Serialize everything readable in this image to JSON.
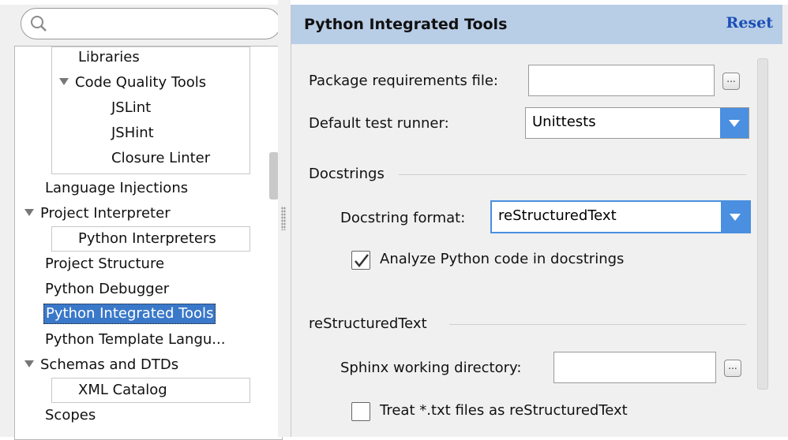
{
  "search": {
    "placeholder": ""
  },
  "tree": {
    "sub_libraries": "Libraries",
    "code_quality": "Code Quality Tools",
    "jslint": "JSLint",
    "jshint": "JSHint",
    "closure": "Closure Linter",
    "lang_inj": "Language Injections",
    "proj_interp": "Project Interpreter",
    "python_interps": "Python Interpreters",
    "proj_struct": "Project Structure",
    "py_debugger": "Python Debugger",
    "py_tools": "Python Integrated Tools",
    "py_template": "Python Template Langu...",
    "schemas": "Schemas and DTDs",
    "xml_catalog": "XML Catalog",
    "scopes": "Scopes"
  },
  "panel": {
    "title": "Python Integrated Tools",
    "reset": "Reset",
    "pkg_req_label": "Package requirements file:",
    "pkg_req_value": "",
    "test_runner_label": "Default test runner:",
    "test_runner_value": "Unittests",
    "docstrings_section": "Docstrings",
    "docstring_format_label": "Docstring format:",
    "docstring_format_value": "reStructuredText",
    "analyze_label": "Analyze Python code in docstrings",
    "analyze_checked": true,
    "rst_section": "reStructuredText",
    "sphinx_label": "Sphinx working directory:",
    "sphinx_value": "",
    "treat_txt_label": "Treat *.txt files as reStructuredText",
    "treat_txt_checked": false,
    "browse_glyph": "..."
  },
  "colors": {
    "header_bg": "#b8cde6",
    "selection": "#3a78c9",
    "accent": "#4a8fe0",
    "reset_link": "#1a4fb5"
  }
}
